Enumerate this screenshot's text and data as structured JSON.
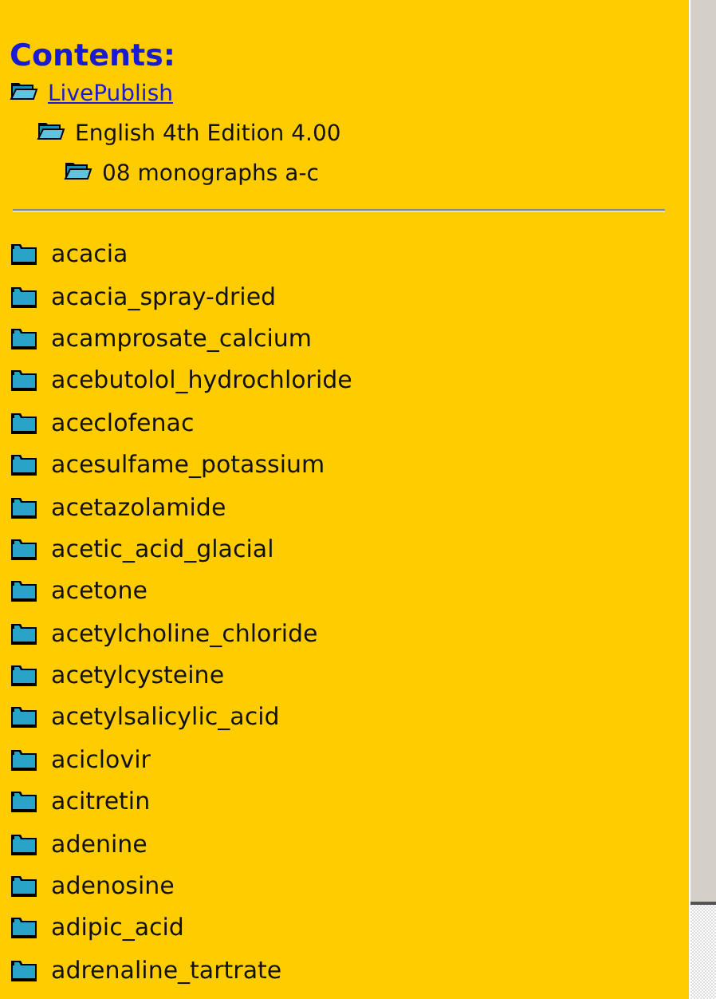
{
  "contents": {
    "title": "Contents:",
    "breadcrumb": [
      {
        "label": "LivePublish",
        "kind": "link"
      },
      {
        "label": "English 4th Edition 4.00",
        "kind": "text"
      },
      {
        "label": "08 monographs a-c",
        "kind": "text"
      }
    ]
  },
  "items": [
    "acacia",
    "acacia_spray-dried",
    "acamprosate_calcium",
    "acebutolol_hydrochloride",
    "aceclofenac",
    "acesulfame_potassium",
    "acetazolamide",
    "acetic_acid_glacial",
    "acetone",
    "acetylcholine_chloride",
    "acetylcysteine",
    "acetylsalicylic_acid",
    "aciclovir",
    "acitretin",
    "adenine",
    "adenosine",
    "adipic_acid",
    "adrenaline_tartrate"
  ]
}
